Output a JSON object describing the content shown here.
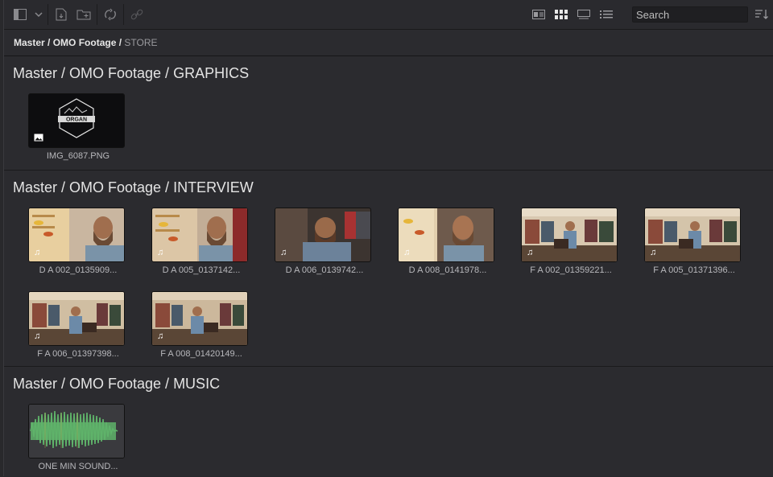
{
  "toolbar": {
    "search_placeholder": "Search"
  },
  "breadcrumb": {
    "path_parts": [
      "Master",
      "OMO Footage"
    ],
    "current": "STORE"
  },
  "sections": [
    {
      "title": "Master / OMO Footage / GRAPHICS",
      "clips": [
        {
          "name": "IMG_6087.PNG",
          "type": "image",
          "logo_text": "ORGAN"
        }
      ]
    },
    {
      "title": "Master / OMO Footage / INTERVIEW",
      "clips": [
        {
          "name": "D A 002_0135909...",
          "type": "video"
        },
        {
          "name": "D A 005_0137142...",
          "type": "video"
        },
        {
          "name": "D A 006_0139742...",
          "type": "video"
        },
        {
          "name": "D A 008_0141978...",
          "type": "video"
        },
        {
          "name": "F A 002_01359221...",
          "type": "video"
        },
        {
          "name": "F A 005_01371396...",
          "type": "video"
        },
        {
          "name": "F A 006_01397398...",
          "type": "video"
        },
        {
          "name": "F A 008_01420149...",
          "type": "video"
        }
      ]
    },
    {
      "title": "Master / OMO Footage / MUSIC",
      "clips": [
        {
          "name": "ONE MIN SOUND...",
          "type": "audio"
        }
      ]
    }
  ],
  "colors": {
    "background": "#2b2b2f",
    "waveform": "#5fb36a",
    "text": "#e4e4e4"
  }
}
